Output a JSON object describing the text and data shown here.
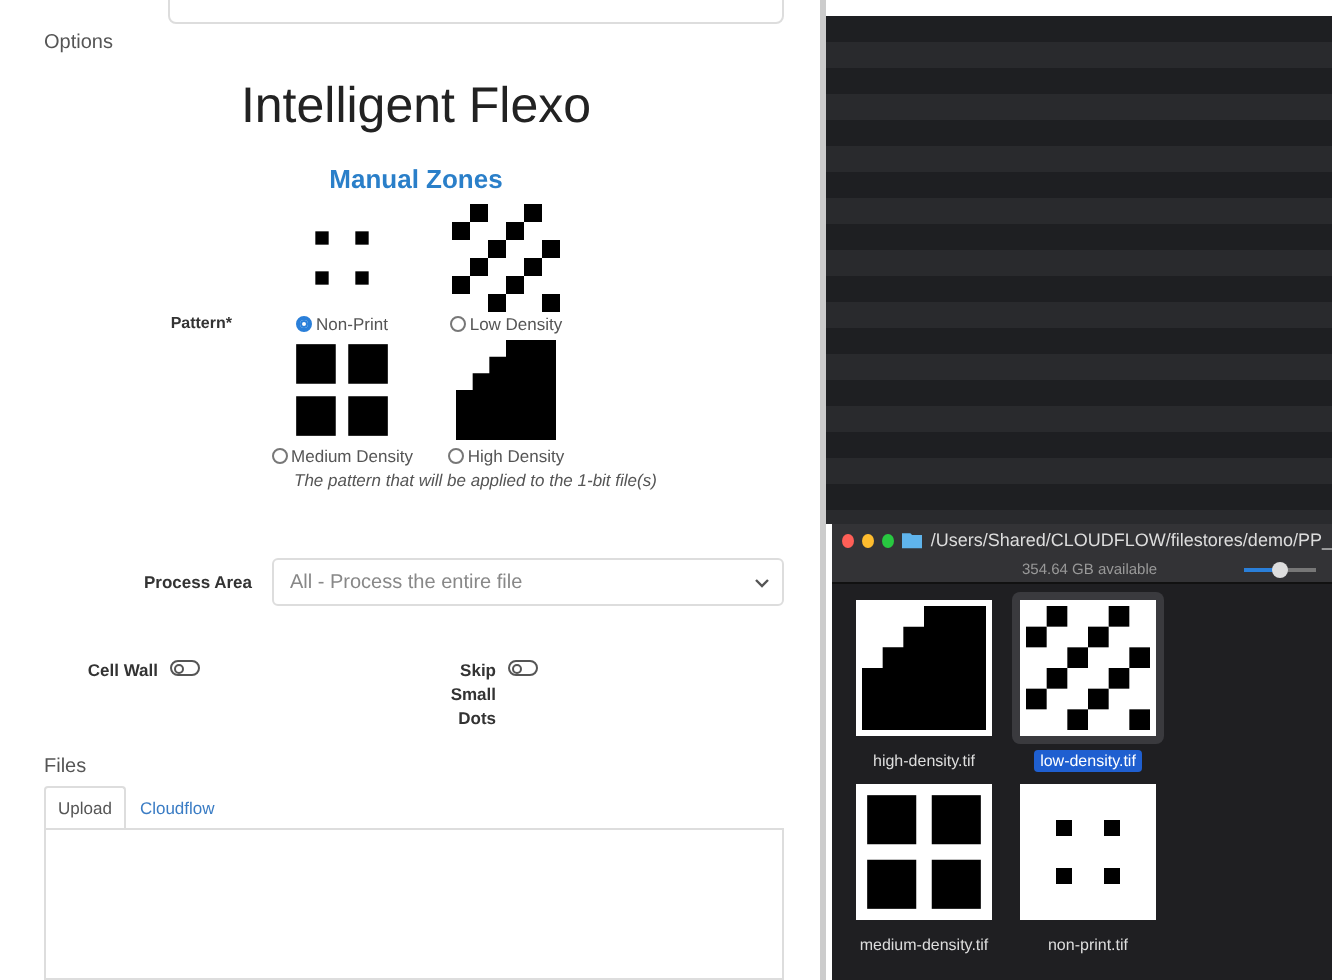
{
  "section_label": "Options",
  "title": "Intelligent Flexo",
  "subtitle": "Manual Zones",
  "pattern": {
    "label": "Pattern*",
    "options": [
      {
        "kind": "non-print",
        "label": "Non-Print",
        "selected": true
      },
      {
        "kind": "low",
        "label": "Low Density",
        "selected": false
      },
      {
        "kind": "medium",
        "label": "Medium Density",
        "selected": false
      },
      {
        "kind": "high",
        "label": "High Density",
        "selected": false
      }
    ],
    "help": "The pattern that will be applied to the 1-bit file(s)"
  },
  "process_area": {
    "label": "Process Area",
    "value": "All - Process the entire file"
  },
  "toggles": [
    {
      "label": "Cell Wall",
      "on": false
    },
    {
      "label": "Skip Small Dots",
      "on": false
    }
  ],
  "files": {
    "label": "Files",
    "tabs": [
      {
        "label": "Upload",
        "selected": true
      },
      {
        "label": "Cloudflow",
        "selected": false
      }
    ]
  },
  "finder": {
    "path": "/Users/Shared/CLOUDFLOW/filestores/demo/PP_",
    "available": "354.64 GB available",
    "zoom": {
      "level": 0.5
    },
    "items": [
      {
        "kind": "high",
        "name": "high-density.tif",
        "selected": false
      },
      {
        "kind": "low",
        "name": "low-density.tif",
        "selected": true
      },
      {
        "kind": "medium",
        "name": "medium-density.tif",
        "selected": false
      },
      {
        "kind": "non-print",
        "name": "non-print.tif",
        "selected": false
      }
    ]
  }
}
